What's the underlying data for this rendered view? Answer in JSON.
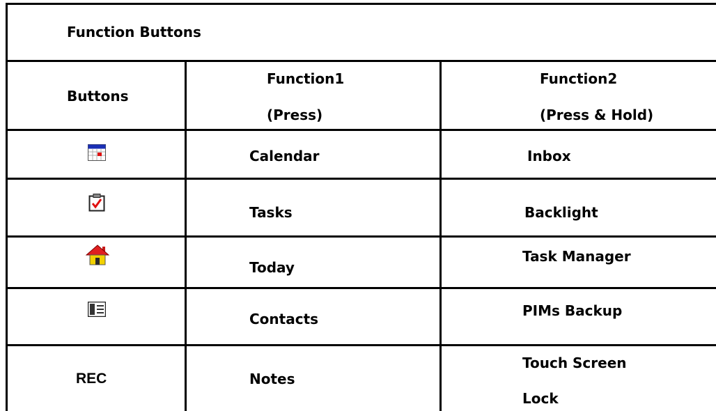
{
  "table": {
    "title": "Function Buttons",
    "headers": {
      "buttons": "Buttons",
      "function1_line1": "Function1",
      "function1_line2": "(Press)",
      "function2_line1": "Function2",
      "function2_line2": "(Press & Hold)"
    },
    "rows": [
      {
        "button_icon": "calendar-icon",
        "function1": "Calendar",
        "function2": "Inbox"
      },
      {
        "button_icon": "tasks-clipboard-icon",
        "function1": "Tasks",
        "function2": "Backlight"
      },
      {
        "button_icon": "home-icon",
        "function1": "Today",
        "function2": "Task Manager"
      },
      {
        "button_icon": "contacts-card-icon",
        "function1": "Contacts",
        "function2": "PIMs Backup"
      },
      {
        "button_label": "REC",
        "function1": "Notes",
        "function2_line1": "Touch Screen",
        "function2_line2": "Lock"
      }
    ]
  },
  "colors": {
    "border": "#000000",
    "calendar_header": "#1a2fb5",
    "mark_red": "#e01010",
    "house_roof": "#e02020",
    "house_body": "#f2d200"
  }
}
